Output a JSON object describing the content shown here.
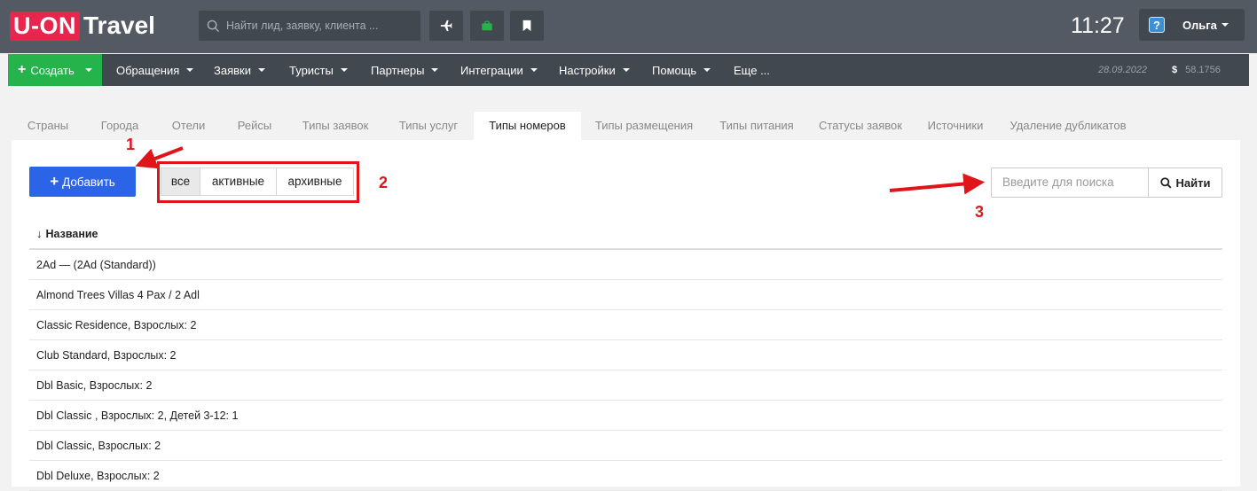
{
  "app": {
    "logo_box": "U-ON",
    "logo_text": "Travel",
    "search_placeholder": "Найти лид, заявку, клиента ...",
    "clock": "11:27",
    "user_name": "Ольга"
  },
  "menu": {
    "create_label": "Создать",
    "items": [
      "Обращения",
      "Заявки",
      "Туристы",
      "Партнеры",
      "Интеграции",
      "Настройки",
      "Помощь",
      "Еще ..."
    ],
    "date": "28.09.2022",
    "rate_symbol": "$",
    "rate_value": "58.1756"
  },
  "tabs": [
    "Страны",
    "Города",
    "Отели",
    "Рейсы",
    "Типы заявок",
    "Типы услуг",
    "Типы номеров",
    "Типы размещения",
    "Типы питания",
    "Статусы заявок",
    "Источники",
    "Удаление дубликатов"
  ],
  "active_tab": "Типы номеров",
  "toolbar": {
    "add_label": "Добавить",
    "filters": [
      "все",
      "активные",
      "архивные"
    ],
    "active_filter": "все",
    "search_placeholder": "Введите для поиска",
    "search_button": "Найти"
  },
  "annotations": {
    "one": "1",
    "two": "2",
    "three": "3"
  },
  "table": {
    "header": "Название",
    "rows": [
      "2Ad — (2Ad (Standard))",
      "Almond Trees Villas 4 Pax / 2 Adl",
      "Classic Residence, Взрослых: 2",
      "Club Standard, Взрослых: 2",
      "Dbl Basic, Взрослых: 2",
      "Dbl Classic , Взрослых: 2, Детей 3-12: 1",
      "Dbl Classic, Взрослых: 2",
      "Dbl Deluxe, Взрослых: 2"
    ]
  },
  "colors": {
    "topbar": "#535a63",
    "menubar": "#42484f",
    "create_green": "#27b34b",
    "add_blue": "#2c64e8",
    "logo_red": "#e8254c",
    "annotation_red": "#e0151a"
  }
}
